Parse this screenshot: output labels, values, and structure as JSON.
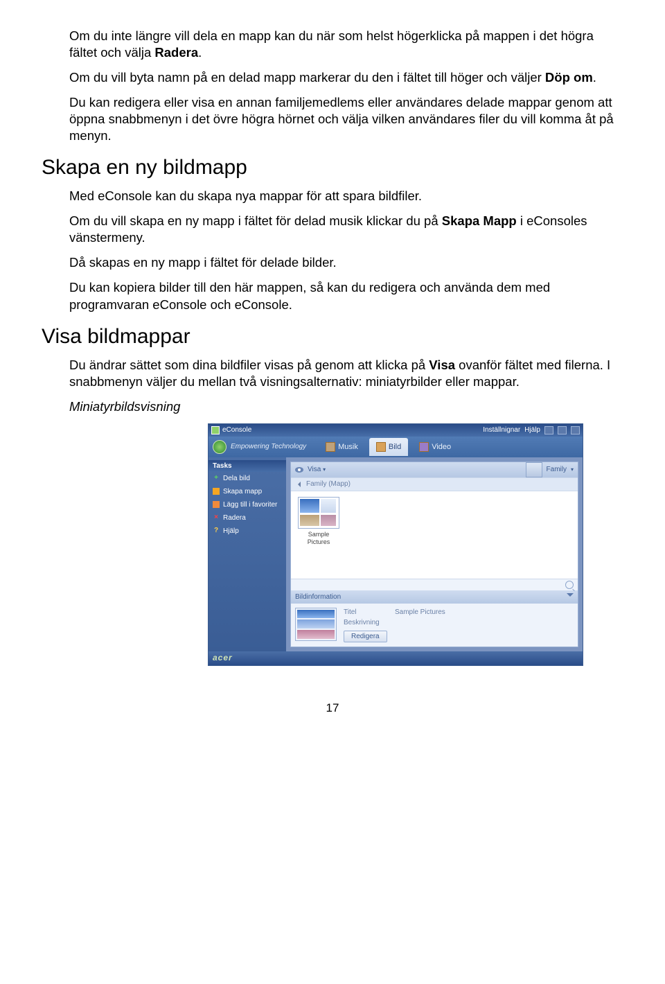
{
  "paragraphs": {
    "p1a": "Om du inte längre vill dela en mapp kan du när som helst högerklicka på mappen i det högra fältet och välja ",
    "p1b": "Radera",
    "p1c": ".",
    "p2a": "Om du vill byta namn på en delad mapp markerar du den i fältet till höger och väljer ",
    "p2b": "Döp om",
    "p2c": ".",
    "p3": "Du kan redigera eller visa en annan familjemedlems eller användares delade mappar genom att öppna snabbmenyn i det övre högra hörnet och välja vilken användares filer du vill komma åt på menyn.",
    "h2a": "Skapa en ny bildmapp",
    "p4": "Med eConsole kan du skapa nya mappar för att spara bildfiler.",
    "p5a": "Om du vill skapa en ny mapp i fältet för delad musik klickar du på ",
    "p5b": "Skapa Mapp",
    "p5c": " i eConsoles vänstermeny.",
    "p6": "Då skapas en ny mapp i fältet för delade bilder.",
    "p7": "Du kan kopiera bilder till den här mappen, så kan du redigera och använda dem med programvaran eConsole och eConsole.",
    "h2b": "Visa bildmappar",
    "p8a": "Du ändrar sättet som dina bildfiler visas på genom att klicka på ",
    "p8b": "Visa",
    "p8c": " ovanför fältet med filerna. I snabbmenyn väljer du mellan två visningsalternativ: miniatyrbilder eller mappar.",
    "p9": "Miniatyrbildsvisning"
  },
  "app": {
    "title": "eConsole",
    "settings": "Inställnignar",
    "help": "Hjälp",
    "brand": "Empowering Technology",
    "tabs": {
      "musik": "Musik",
      "bild": "Bild",
      "video": "Video"
    },
    "tasks_head": "Tasks",
    "tasks": {
      "share": "Dela bild",
      "create": "Skapa mapp",
      "fav": "Lägg till i favoriter",
      "del": "Radera",
      "help": "Hjälp"
    },
    "view_label": "Visa",
    "user": "Family",
    "breadcrumb": "Family (Mapp)",
    "thumb_caption": "Sample Pictures",
    "info_header": "Bildinformation",
    "field_title_label": "Titel",
    "field_title_value": "Sample Pictures",
    "field_desc_label": "Beskrivning",
    "edit_btn": "Redigera",
    "footer_logo": "acer"
  },
  "page_number": "17"
}
